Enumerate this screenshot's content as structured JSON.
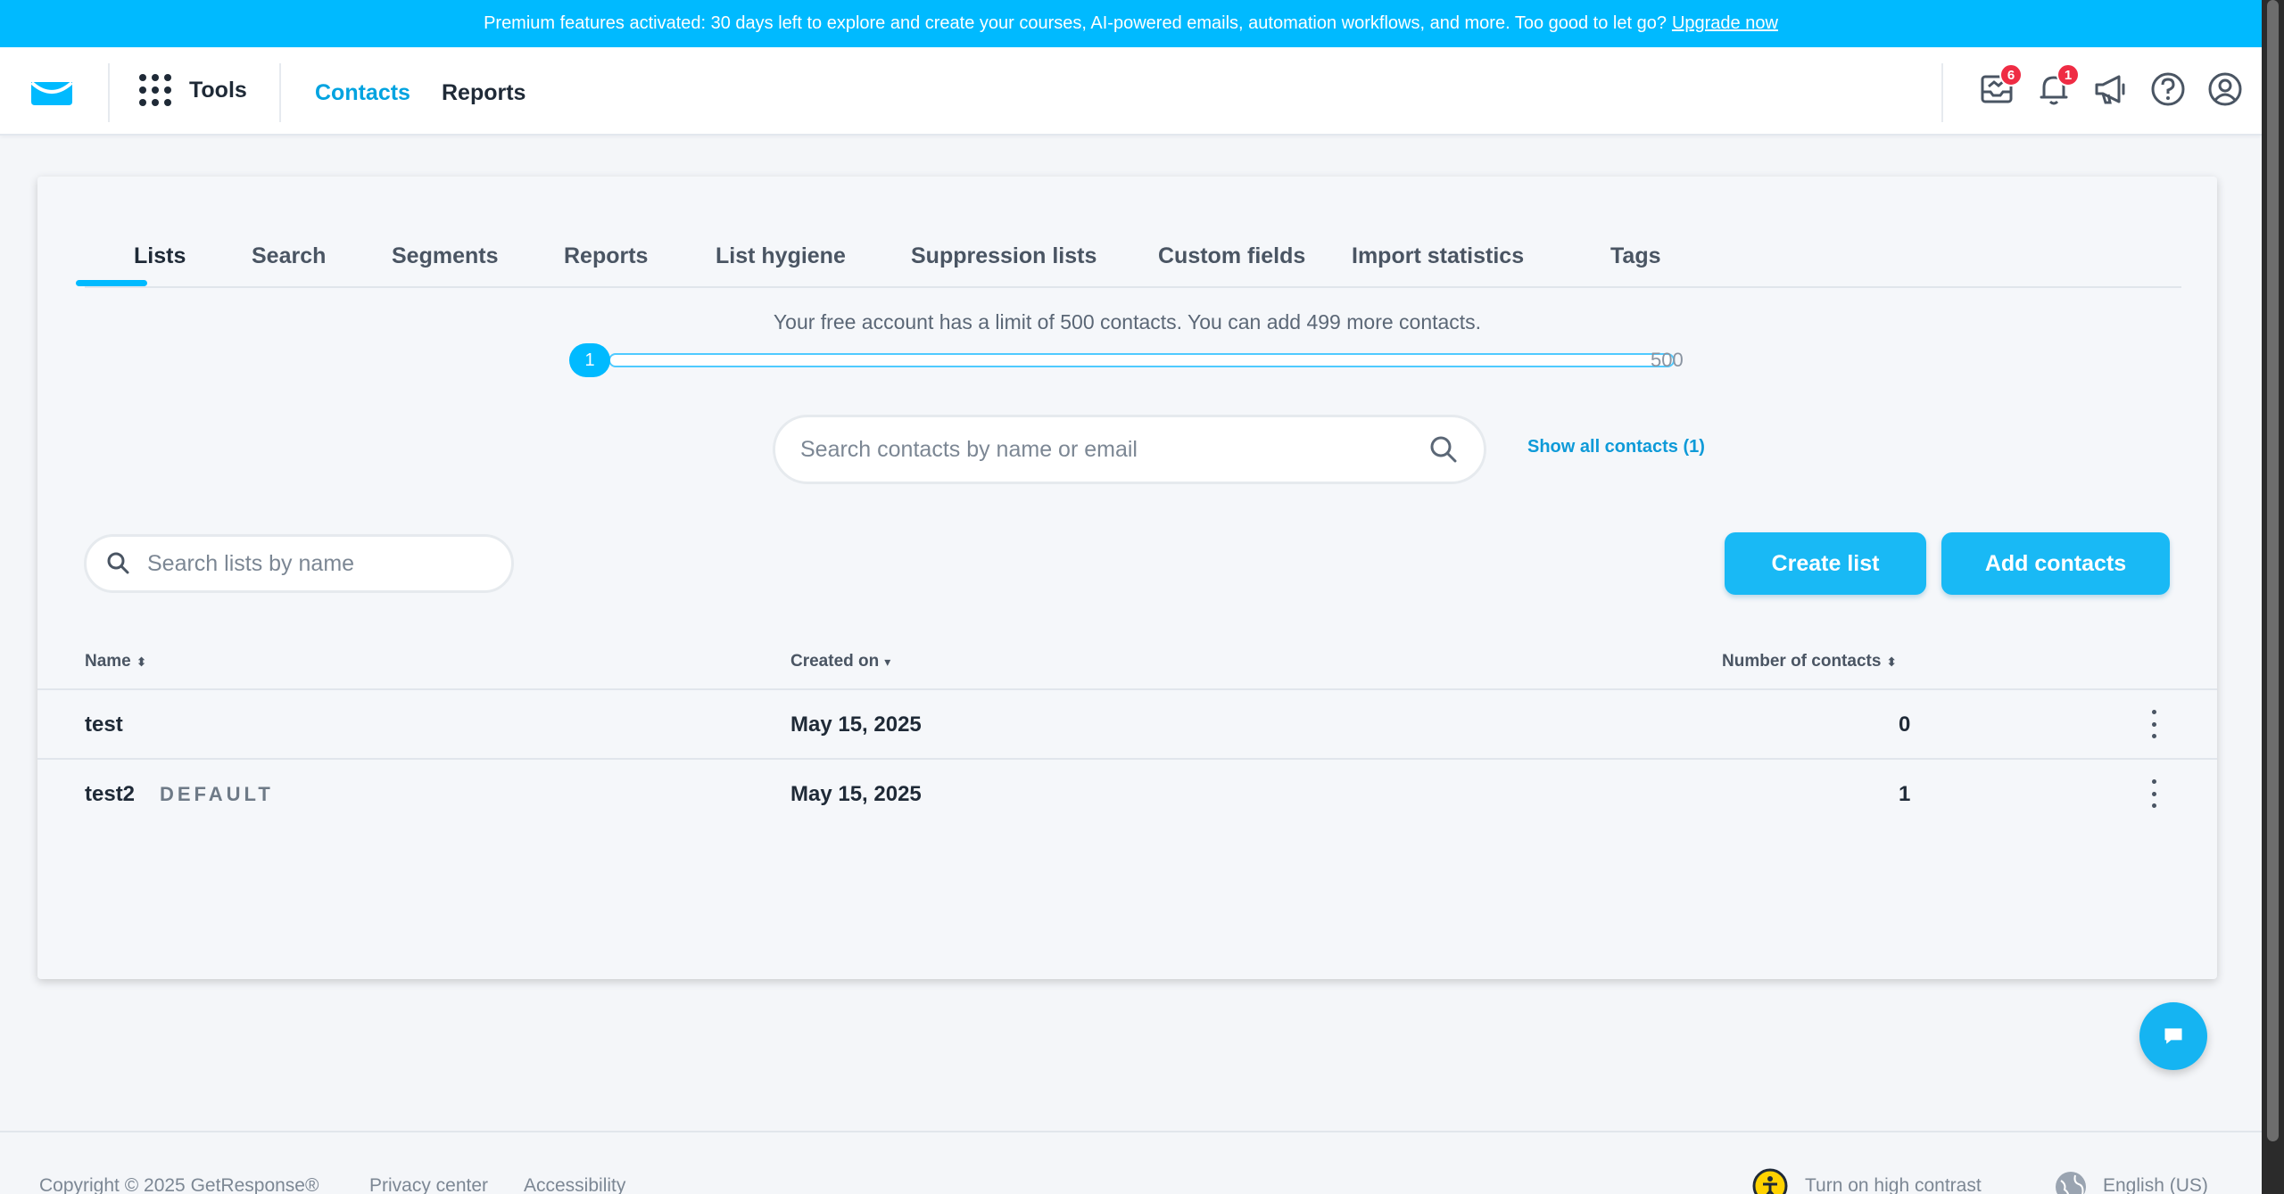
{
  "banner": {
    "text": "Premium features activated: 30 days left to explore and create your courses, AI-powered emails, automation workflows, and more. Too good to let go?",
    "link": "Upgrade now"
  },
  "nav": {
    "tools": "Tools",
    "links": [
      "Contacts",
      "Reports"
    ],
    "badges": {
      "messages": "6",
      "notifications": "1"
    }
  },
  "tabs": [
    "Lists",
    "Search",
    "Segments",
    "Reports",
    "List hygiene",
    "Suppression lists",
    "Custom fields",
    "Import statistics",
    "Tags"
  ],
  "limit": {
    "text": "Your free account has a limit of 500 contacts. You can add 499 more contacts.",
    "current": "1",
    "max": "500",
    "fraction": 0.002
  },
  "contact_search": {
    "placeholder": "Search contacts by name or email",
    "show_all": "Show all contacts (1)"
  },
  "list_search": {
    "placeholder": "Search lists by name"
  },
  "buttons": {
    "create_list": "Create list",
    "add_contacts": "Add contacts"
  },
  "table": {
    "headers": [
      "Name",
      "Created on",
      "Number of contacts"
    ],
    "rows": [
      {
        "name": "test",
        "tag": "",
        "created": "May 15, 2025",
        "count": "0"
      },
      {
        "name": "test2",
        "tag": "DEFAULT",
        "created": "May 15, 2025",
        "count": "1"
      }
    ]
  },
  "footer": {
    "copyright": "Copyright © 2025 GetResponse®",
    "privacy": "Privacy center",
    "accessibility": "Accessibility",
    "contrast": "Turn on high contrast",
    "language": "English (US)"
  },
  "colors": {
    "accent": "#00baff",
    "link": "#00a3e0",
    "badge": "#ef2c44"
  }
}
